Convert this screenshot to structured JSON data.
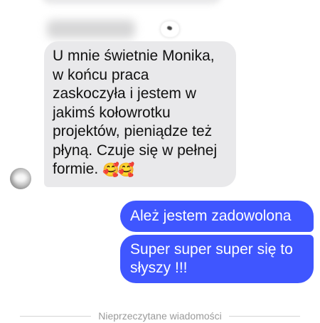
{
  "messages": {
    "incoming": {
      "text": "U mnie świetnie Monika,\nw końcu praca\nzaskoczyła i jestem w\njakimś kołowrotku\nprojektów, pieniądze też\npłyną. Czuje się w pełnej\nformie.",
      "emoji": "🥰🥰"
    },
    "outgoing": [
      {
        "text": "Ależ jestem zadowolona"
      },
      {
        "text": "Super super super się to\nsłyszy !!!"
      }
    ]
  },
  "divider": {
    "label": "Nieprzeczytane wiadomości"
  },
  "colors": {
    "incoming_bubble": "#e9e9eb",
    "outgoing_bubble": "#3f56ff",
    "divider_text": "#9a9a9a"
  },
  "icons": {
    "reaction": "reaction-icon",
    "avatar": "avatar"
  }
}
